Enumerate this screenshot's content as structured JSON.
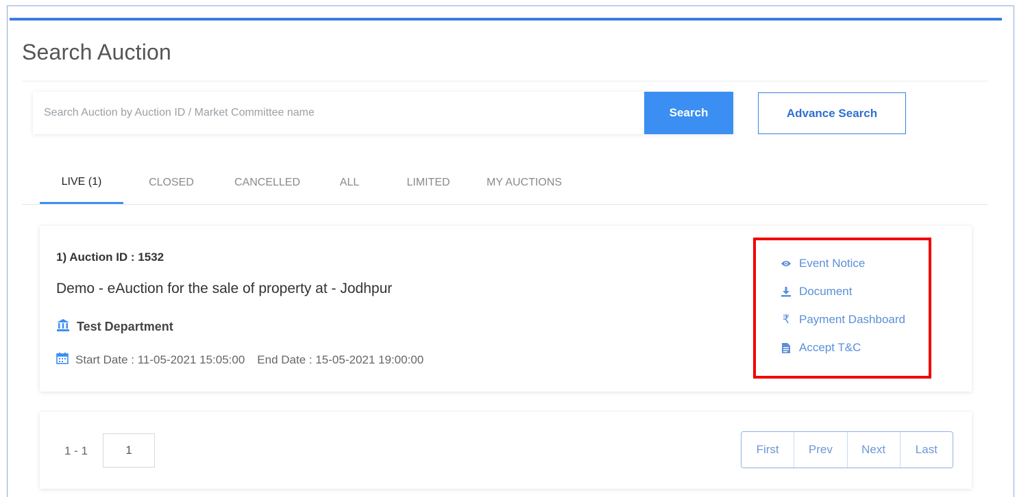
{
  "page": {
    "title": "Search Auction"
  },
  "search": {
    "placeholder": "Search Auction by Auction ID / Market Committee name",
    "value": "",
    "button_label": "Search",
    "advance_label": "Advance Search"
  },
  "tabs": [
    {
      "label": "LIVE (1)",
      "active": true
    },
    {
      "label": "CLOSED",
      "active": false
    },
    {
      "label": "CANCELLED",
      "active": false
    },
    {
      "label": "ALL",
      "active": false
    },
    {
      "label": "LIMITED",
      "active": false
    },
    {
      "label": "MY AUCTIONS",
      "active": false
    }
  ],
  "auction": {
    "id_label": "1) Auction ID : 1532",
    "title": "Demo - eAuction for the sale of property at - Jodhpur",
    "department": "Test Department",
    "start_date": "Start Date : 11-05-2021 15:05:00",
    "end_date": "End Date : 15-05-2021 19:00:00",
    "actions": [
      {
        "label": "Event Notice",
        "icon": "eye-icon"
      },
      {
        "label": "Document",
        "icon": "download-icon"
      },
      {
        "label": "Payment Dashboard",
        "icon": "rupee-icon"
      },
      {
        "label": "Accept T&C",
        "icon": "file-text-icon"
      }
    ]
  },
  "pagination": {
    "range": "1 - 1",
    "current_page": "1",
    "buttons": [
      "First",
      "Prev",
      "Next",
      "Last"
    ]
  },
  "colors": {
    "accent": "#3b8ff2",
    "highlight": "#f20000",
    "link": "#5b8fd8"
  }
}
